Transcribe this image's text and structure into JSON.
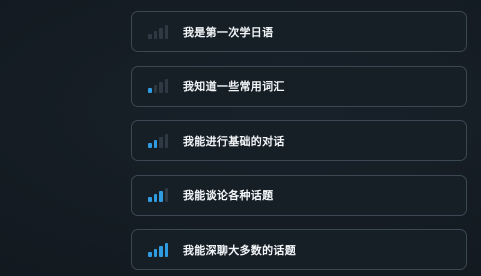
{
  "accent_color": "#2f9be0",
  "options": [
    {
      "label": "我是第一次学日语",
      "icon": "signal-level-0-icon",
      "level": 0
    },
    {
      "label": "我知道一些常用词汇",
      "icon": "signal-level-1-icon",
      "level": 1
    },
    {
      "label": "我能进行基础的对话",
      "icon": "signal-level-2-icon",
      "level": 2
    },
    {
      "label": "我能谈论各种话题",
      "icon": "signal-level-3-icon",
      "level": 3
    },
    {
      "label": "我能深聊大多数的话题",
      "icon": "signal-level-4-icon",
      "level": 4
    }
  ]
}
